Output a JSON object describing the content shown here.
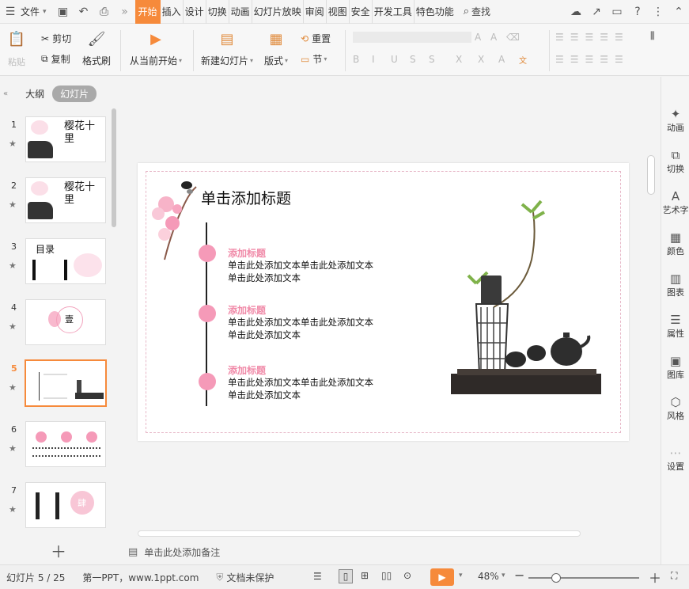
{
  "menubar": {
    "file_label": "文件",
    "tabs": [
      {
        "label": "开始",
        "active": true
      },
      {
        "label": "插入"
      },
      {
        "label": "设计"
      },
      {
        "label": "切换"
      },
      {
        "label": "动画"
      },
      {
        "label": "幻灯片放映"
      },
      {
        "label": "审阅"
      },
      {
        "label": "视图"
      },
      {
        "label": "安全"
      },
      {
        "label": "开发工具"
      },
      {
        "label": "特色功能"
      }
    ],
    "search_label": "查找",
    "accent_color": "#f68a3b"
  },
  "ribbon": {
    "paste_label": "粘贴",
    "cut_label": "剪切",
    "copy_label": "复制",
    "format_painter_label": "格式刷",
    "from_current_label": "从当前开始",
    "new_slide_label": "新建幻灯片",
    "layout_label": "版式",
    "reset_label": "重置",
    "section_label": "节"
  },
  "leftpanel": {
    "outline_tab": "大纲",
    "slides_tab": "幻灯片",
    "slides": [
      {
        "num": "1",
        "text": "樱花十里"
      },
      {
        "num": "2",
        "text": "樱花十里"
      },
      {
        "num": "3",
        "text": "目录"
      },
      {
        "num": "4",
        "text": "壹"
      },
      {
        "num": "5",
        "text": ""
      },
      {
        "num": "6",
        "text": ""
      },
      {
        "num": "7",
        "text": "肆"
      }
    ],
    "current_slide": 5
  },
  "slide": {
    "title": "单击添加标题",
    "items": [
      {
        "heading": "添加标题",
        "line1": "单击此处添加文本单击此处添加文本",
        "line2": "单击此处添加文本"
      },
      {
        "heading": "添加标题",
        "line1": "单击此处添加文本单击此处添加文本",
        "line2": "单击此处添加文本"
      },
      {
        "heading": "添加标题",
        "line1": "单击此处添加文本单击此处添加文本",
        "line2": "单击此处添加文本"
      }
    ],
    "accent_pink": "#f59ab8"
  },
  "notes": {
    "placeholder": "单击此处添加备注"
  },
  "rightbar": {
    "items": [
      {
        "label": "动画",
        "icon": "animation-icon"
      },
      {
        "label": "切换",
        "icon": "transition-icon"
      },
      {
        "label": "艺术字",
        "icon": "wordart-icon"
      },
      {
        "label": "颜色",
        "icon": "color-icon"
      },
      {
        "label": "图表",
        "icon": "chart-icon"
      },
      {
        "label": "属性",
        "icon": "properties-icon"
      },
      {
        "label": "图库",
        "icon": "gallery-icon"
      },
      {
        "label": "风格",
        "icon": "style-icon"
      },
      {
        "label": "设置",
        "icon": "settings-icon"
      }
    ]
  },
  "statusbar": {
    "slide_count": "幻灯片 5 / 25",
    "source": "第一PPT，www.1ppt.com",
    "protection": "文档未保护",
    "zoom": "48%",
    "zoom_fraction": 0.25
  }
}
